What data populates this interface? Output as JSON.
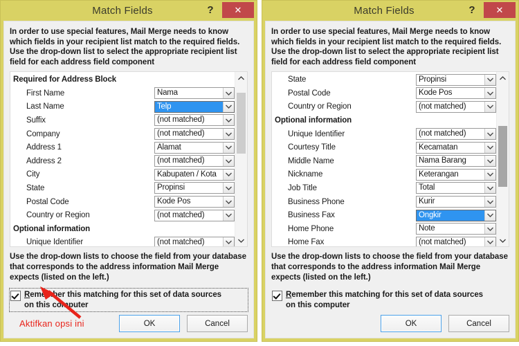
{
  "window_chrome": {
    "frame_color": "#d9d264",
    "close_color": "#c1484a",
    "accent_blue": "#2f94f0",
    "annotation_red": "#e8241b"
  },
  "title": "Match Fields",
  "help_label": "?",
  "close_label": "✕",
  "intro_text": "In order to use special features, Mail Merge needs to know which fields in your recipient list match to the required fields. Use the drop-down list to select the appropriate recipient list field for each address field component",
  "hint_text": "Use the drop-down lists to choose the field from your database that corresponds to the address information Mail Merge expects (listed on the left.)",
  "checkbox": {
    "accel": "R",
    "label_rest": "emember this matching for this set of data sources on this computer",
    "checked": true
  },
  "buttons": {
    "ok": "OK",
    "cancel": "Cancel"
  },
  "annotation": {
    "text": "Aktifkan opsi ini"
  },
  "not_matched": "(not matched)",
  "left_dialog": {
    "scroll_thumb_top_pct": 6,
    "scroll_thumb_height_pct": 40,
    "rows": [
      {
        "label": "Required for Address Block",
        "group": true
      },
      {
        "label": "First Name",
        "value": "Nama",
        "selected": false
      },
      {
        "label": "Last Name",
        "value": "Telp",
        "selected": true
      },
      {
        "label": "Suffix",
        "value": "(not matched)",
        "selected": false
      },
      {
        "label": "Company",
        "value": "(not matched)",
        "selected": false
      },
      {
        "label": "Address 1",
        "value": "Alamat",
        "selected": false
      },
      {
        "label": "Address 2",
        "value": "(not matched)",
        "selected": false
      },
      {
        "label": "City",
        "value": "Kabupaten / Kota",
        "selected": false
      },
      {
        "label": "State",
        "value": "Propinsi",
        "selected": false
      },
      {
        "label": "Postal Code",
        "value": "Kode Pos",
        "selected": false
      },
      {
        "label": "Country or Region",
        "value": "(not matched)",
        "selected": false
      },
      {
        "label": "Optional information",
        "group": true
      },
      {
        "label": "Unique Identifier",
        "value": "(not matched)",
        "selected": false
      }
    ]
  },
  "right_dialog": {
    "scroll_thumb_top_pct": 28,
    "scroll_thumb_height_pct": 40,
    "rows": [
      {
        "label": "State",
        "value": "Propinsi",
        "selected": false
      },
      {
        "label": "Postal Code",
        "value": "Kode Pos",
        "selected": false
      },
      {
        "label": "Country or Region",
        "value": "(not matched)",
        "selected": false
      },
      {
        "label": "Optional information",
        "group": true
      },
      {
        "label": "Unique Identifier",
        "value": "(not matched)",
        "selected": false
      },
      {
        "label": "Courtesy Title",
        "value": "Kecamatan",
        "selected": false
      },
      {
        "label": "Middle Name",
        "value": "Nama Barang",
        "selected": false
      },
      {
        "label": "Nickname",
        "value": "Keterangan",
        "selected": false
      },
      {
        "label": "Job Title",
        "value": "Total",
        "selected": false
      },
      {
        "label": "Business Phone",
        "value": "Kurir",
        "selected": false
      },
      {
        "label": "Business Fax",
        "value": "Ongkir",
        "selected": true
      },
      {
        "label": "Home Phone",
        "value": "Note",
        "selected": false
      },
      {
        "label": "Home Fax",
        "value": "(not matched)",
        "selected": false
      }
    ]
  }
}
